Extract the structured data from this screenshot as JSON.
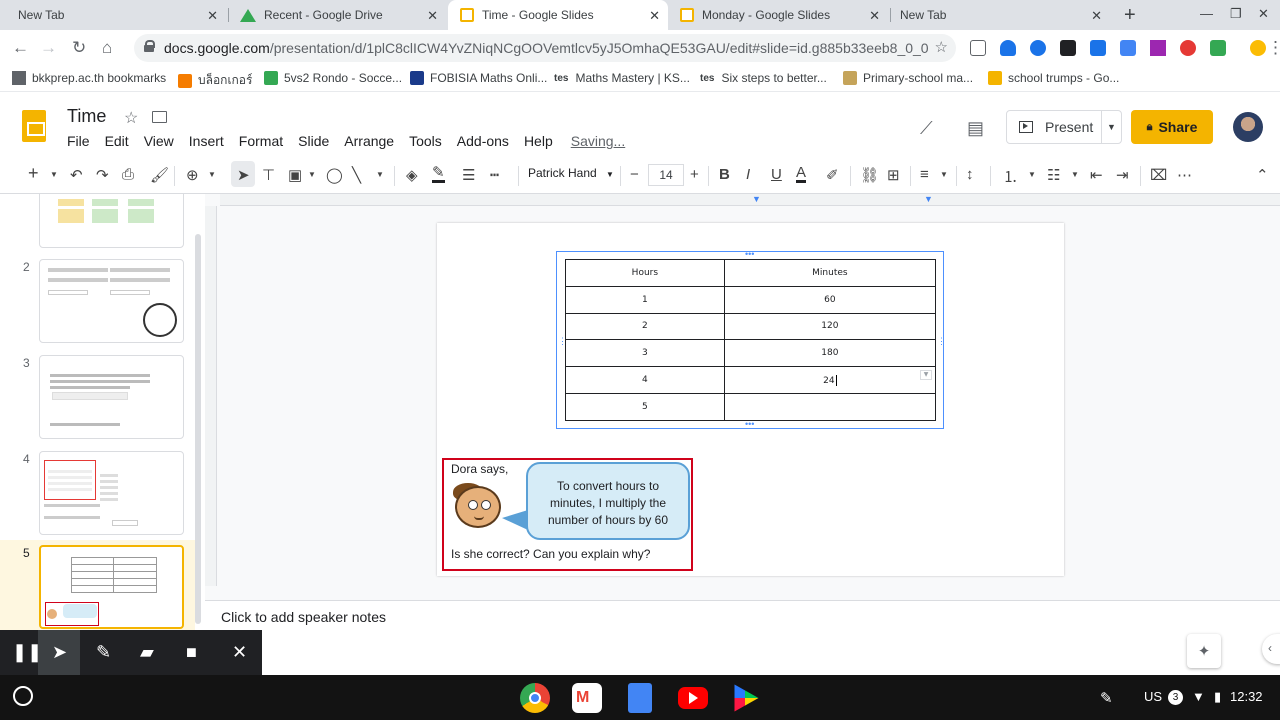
{
  "browser": {
    "tabs": [
      {
        "title": "New Tab",
        "active": false
      },
      {
        "title": "Recent - Google Drive",
        "active": false
      },
      {
        "title": "Time - Google Slides",
        "active": true
      },
      {
        "title": "Monday - Google Slides",
        "active": false
      },
      {
        "title": "New Tab",
        "active": false
      }
    ],
    "url_host": "docs.google.com",
    "url_path": "/presentation/d/1plC8clICW4YvZNiqNCgOOVemtlcv5yJ5OmhaQE53GAU/edit#slide=id.g885b33eeb8_0_0",
    "bookmarks": [
      "bkkprep.ac.th bookmarks",
      "บล็อกเกอร์",
      "5vs2 Rondo - Socce...",
      "FOBISIA Maths Onli...",
      "Maths Mastery | KS...",
      "Six steps to better...",
      "Primary-school ma...",
      "school trumps - Go..."
    ],
    "bookmark_badges": [
      "tes",
      "tes"
    ]
  },
  "slides": {
    "doc_title": "Time",
    "menu": [
      "File",
      "Edit",
      "View",
      "Insert",
      "Format",
      "Slide",
      "Arrange",
      "Tools",
      "Add-ons",
      "Help"
    ],
    "saving_status": "Saving...",
    "present_label": "Present",
    "share_label": "Share",
    "font_name": "Patrick Hand",
    "font_size": "14",
    "thumbnails": [
      "2",
      "3",
      "4",
      "5"
    ],
    "speaker_notes_placeholder": "Click to add speaker notes"
  },
  "slide_content": {
    "table": {
      "headers": [
        "Hours",
        "Minutes"
      ],
      "rows": [
        [
          "1",
          "60"
        ],
        [
          "2",
          "120"
        ],
        [
          "3",
          "180"
        ],
        [
          "4",
          "24"
        ],
        [
          "5",
          ""
        ]
      ]
    },
    "dora_says": "Dora says,",
    "bubble_text": "To convert hours to minutes, I multiply the number of hours by 60",
    "question": "Is she correct? Can you explain why?"
  },
  "system": {
    "locale": "US",
    "notification_count": "3",
    "time": "12:32"
  },
  "colors": {
    "slides_yellow": "#f4b400",
    "selection_blue": "#4d90fe",
    "card_red": "#d0021b",
    "bubble_blue": "#d6ecf7"
  }
}
